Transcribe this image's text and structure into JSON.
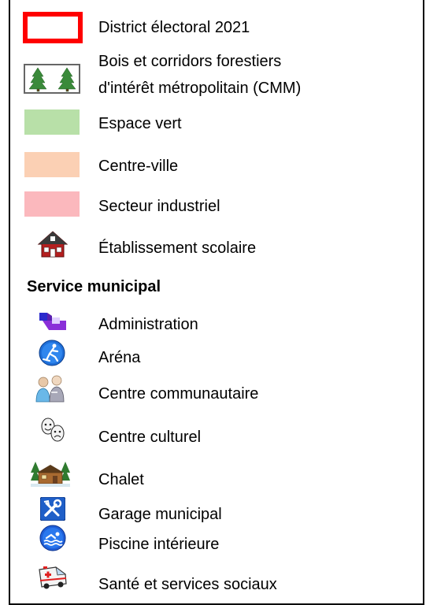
{
  "legend": {
    "items": [
      {
        "label": "District électoral 2021",
        "icon": "red-outline-box"
      },
      {
        "label_line1": "Bois et corridors forestiers",
        "label_line2": "d'intérêt métropolitain (CMM)",
        "icon": "tree-pattern-box"
      },
      {
        "label": "Espace vert",
        "color": "#b8e0a8"
      },
      {
        "label": "Centre-ville",
        "color": "#fbd0b4"
      },
      {
        "label": "Secteur industriel",
        "color": "#fbb8bd"
      },
      {
        "label": "Établissement scolaire",
        "icon": "school-house-icon"
      }
    ],
    "service_heading": "Service municipal",
    "services": [
      {
        "label": "Administration",
        "icon": "administration-icon"
      },
      {
        "label": "Aréna",
        "icon": "arena-hockey-icon"
      },
      {
        "label": "Centre communautaire",
        "icon": "community-people-icon"
      },
      {
        "label": "Centre culturel",
        "icon": "theatre-masks-icon"
      },
      {
        "label": "Chalet",
        "icon": "chalet-icon"
      },
      {
        "label": "Garage municipal",
        "icon": "tools-icon"
      },
      {
        "label": "Piscine intérieure",
        "icon": "swimmer-icon"
      },
      {
        "label": "Santé et services sociaux",
        "icon": "ambulance-icon"
      }
    ]
  }
}
